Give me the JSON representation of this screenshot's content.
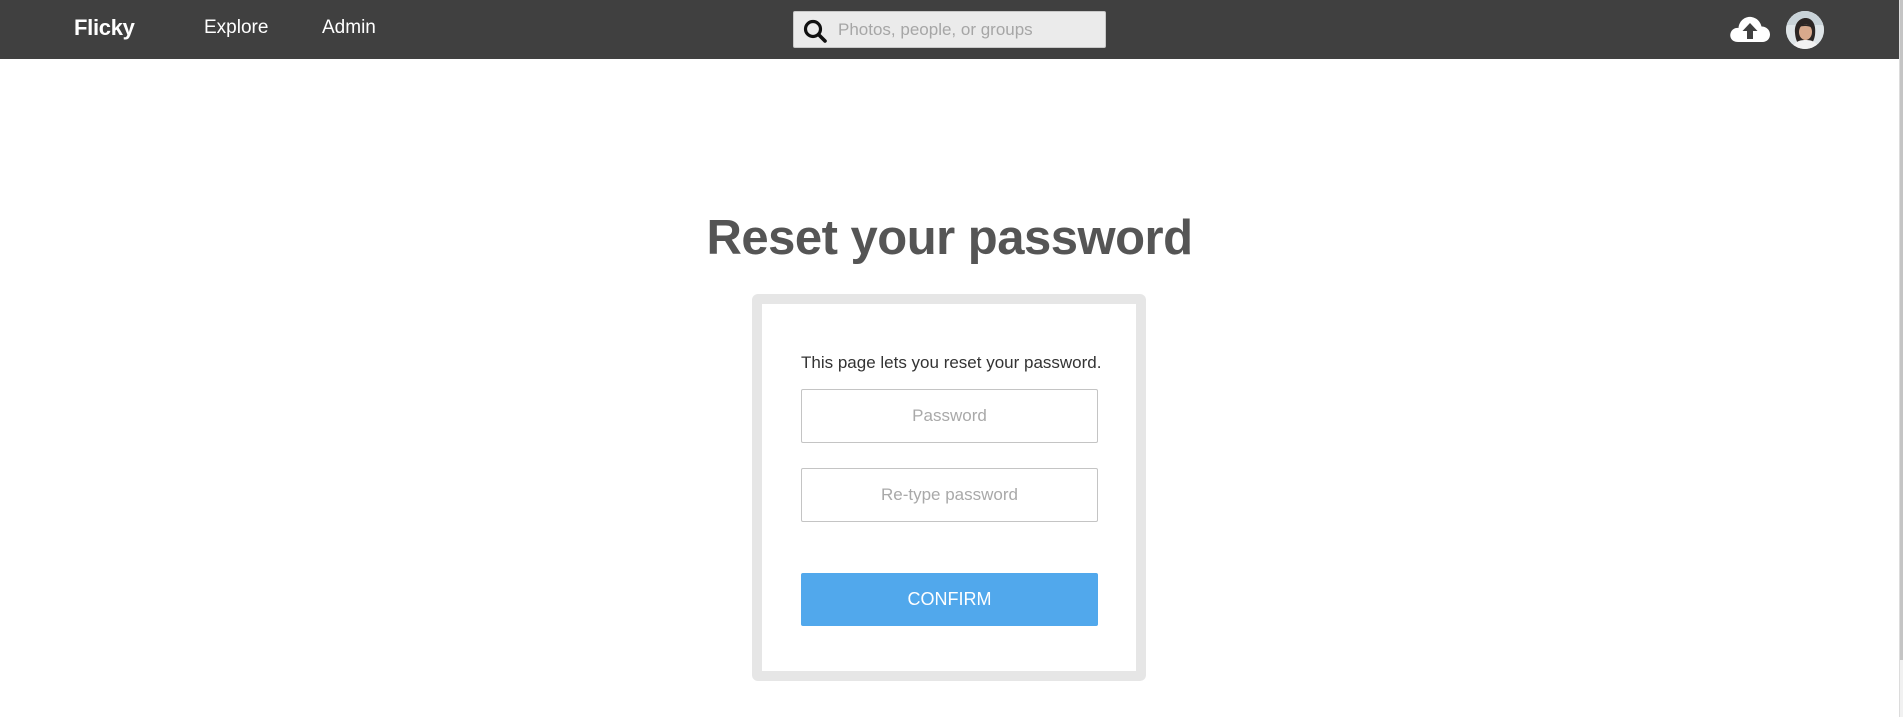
{
  "header": {
    "brand": "Flicky",
    "nav": {
      "explore": "Explore",
      "admin": "Admin"
    },
    "search": {
      "placeholder": "Photos, people, or groups",
      "value": "",
      "icon": "search-icon"
    },
    "upload_icon": "cloud-upload-icon",
    "avatar_icon": "user-avatar"
  },
  "main": {
    "title": "Reset your password",
    "card": {
      "description": "This page lets you reset your password.",
      "password_placeholder": "Password",
      "retype_placeholder": "Re-type password",
      "confirm_label": "CONFIRM"
    }
  },
  "colors": {
    "header_bg": "#404040",
    "title_text": "#555555",
    "card_border": "#e6e6e6",
    "confirm_bg": "#51a8ec"
  }
}
